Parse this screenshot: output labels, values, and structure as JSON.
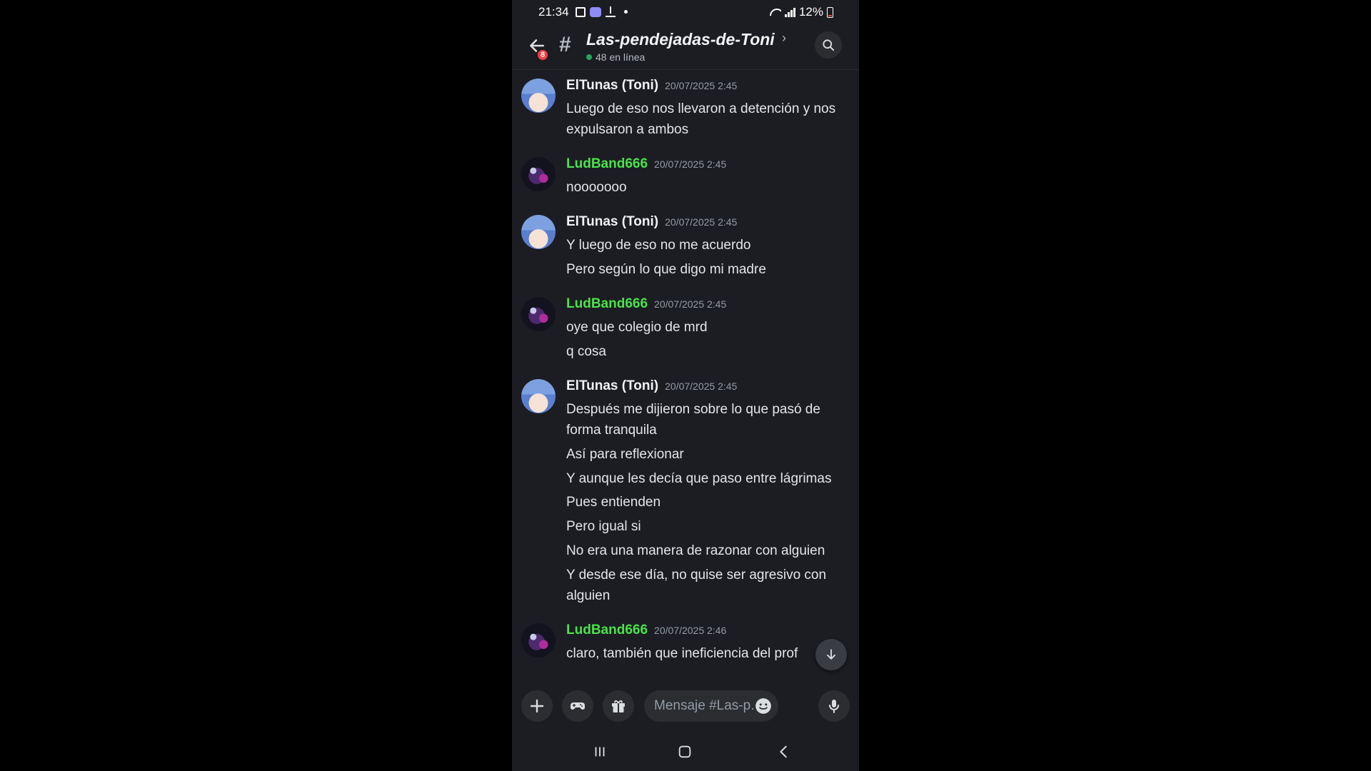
{
  "status_bar": {
    "time": "21:34",
    "battery": "12%"
  },
  "header": {
    "unread_count": "8",
    "channel_hash": "#",
    "channel_name": "Las-pendejadas-de-Toni",
    "chevron": "›",
    "online": "48 en línea"
  },
  "messages": [
    {
      "author": "ElTunas (Toni)",
      "time": "20/07/2025 2:45",
      "avatar": "toni-avatar",
      "lines": [
        "Luego de eso nos llevaron a detención y nos",
        "expulsaron a ambos"
      ]
    },
    {
      "author": "LudBand666",
      "time": "20/07/2025 2:45",
      "avatar": "ludband-avatar",
      "lines": [
        "nooooooo"
      ]
    },
    {
      "author": "ElTunas (Toni)",
      "time": "20/07/2025 2:45",
      "avatar": "toni-avatar",
      "lines": [
        "Y luego de eso no me acuerdo",
        "Pero según lo que digo mi madre"
      ]
    },
    {
      "author": "LudBand666",
      "time": "20/07/2025 2:45",
      "avatar": "ludband-avatar",
      "lines": [
        "oye que colegio de mrd",
        "q cosa"
      ]
    },
    {
      "author": "ElTunas (Toni)",
      "time": "20/07/2025 2:45",
      "avatar": "toni-avatar",
      "lines": [
        "Después me dijieron sobre lo que pasó de",
        "forma tranquila",
        "Así para reflexionar",
        "Y aunque les decía que paso entre lágrimas",
        "Pues entienden",
        "Pero igual si",
        "No era una manera de razonar con alguien",
        "Y desde ese día, no quise ser agresivo con",
        "alguien"
      ]
    },
    {
      "author": "LudBand666",
      "time": "20/07/2025 2:46",
      "avatar": "ludband-avatar",
      "lines": [
        "claro, también que ineficiencia del prof"
      ]
    }
  ],
  "composer": {
    "placeholder": "Mensaje #Las-p..."
  },
  "colors": {
    "background": "#1c1d22",
    "accent_green": "#4be24b",
    "badge_red": "#f23f43",
    "online_green": "#23a55a"
  },
  "icons": [
    "back-arrow-icon",
    "search-icon",
    "plus-icon",
    "gamepad-icon",
    "gift-icon",
    "emoji-icon",
    "microphone-icon",
    "arrow-down-icon",
    "recent-apps-icon",
    "home-icon",
    "nav-back-icon"
  ]
}
